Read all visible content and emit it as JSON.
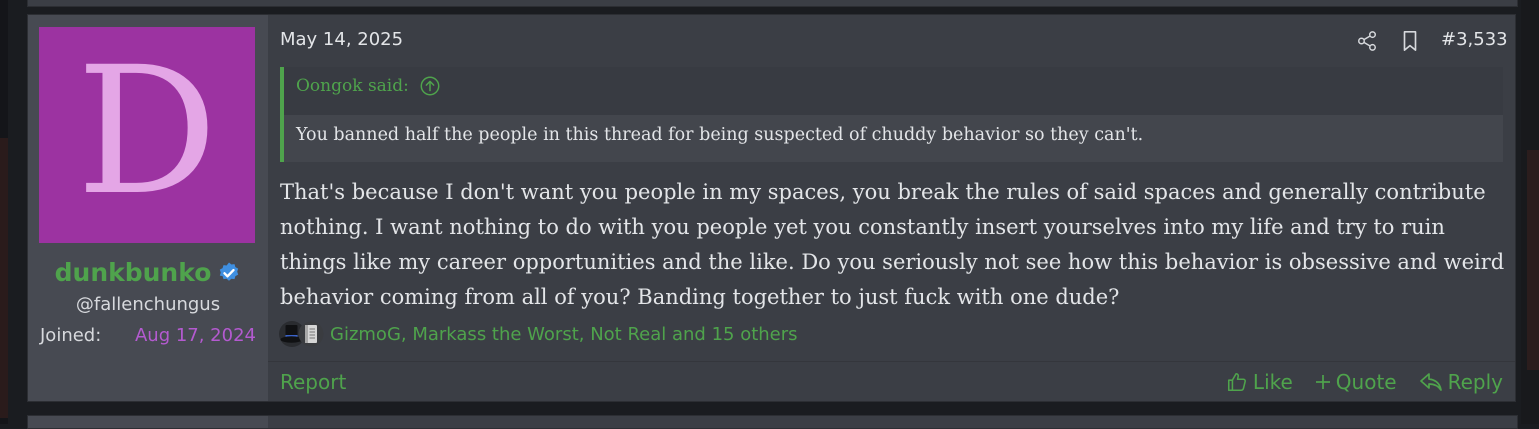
{
  "post": {
    "date": "May 14, 2025",
    "number": "#3,533",
    "user": {
      "avatar_letter": "D",
      "avatar_color": "#9c33a1",
      "username": "dunkbunko",
      "verified": true,
      "handle": "@fallenchungus",
      "joined_label": "Joined:",
      "joined_date": "Aug 17, 2024"
    },
    "quote": {
      "author_label": "Oongok said:",
      "text": "You banned half the people in this thread for being suspected of chuddy behavior so they can't."
    },
    "message": "That's because I don't want you people in my spaces, you break the rules of said spaces and generally contribute nothing. I want nothing to do with you people yet you constantly insert yourselves into my life and try to ruin things like my career opportunities and the like. Do you seriously not see how this behavior is obsessive and weird behavior coming from all of you? Banding together to just fuck with one dude?",
    "reactions": {
      "icons": [
        "tophat-icon",
        "scroll-icon"
      ],
      "text": "GizmoG, Markass the Worst, Not Real and 15 others"
    },
    "footer": {
      "report": "Report",
      "like": "Like",
      "quote": "Quote",
      "reply": "Reply"
    }
  },
  "colors": {
    "accent_green": "#4fa34c",
    "date_purple": "#b45ad0",
    "background": "#3b3e45",
    "user_cell": "#474a52"
  }
}
